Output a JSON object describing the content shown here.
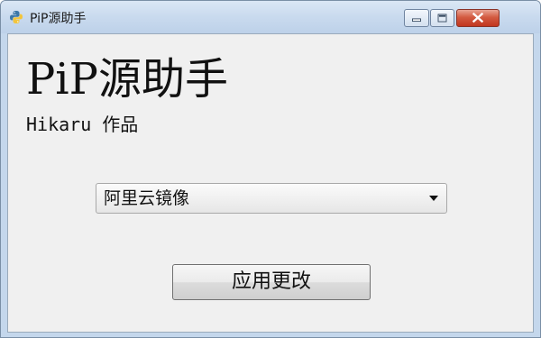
{
  "window": {
    "title": "PiP源助手",
    "icon": "python-logo-icon",
    "controls": {
      "minimize_icon": "minimize-icon",
      "maximize_icon": "maximize-icon",
      "close_icon": "close-icon"
    }
  },
  "main": {
    "heading": "PiP源助手",
    "subtitle": "Hikaru 作品"
  },
  "mirror_select": {
    "selected": "阿里云镜像"
  },
  "apply_button": {
    "label": "应用更改"
  },
  "colors": {
    "titlebar": "#c9daee",
    "client_background": "#f0f0f0",
    "close_button": "#c1361f"
  }
}
